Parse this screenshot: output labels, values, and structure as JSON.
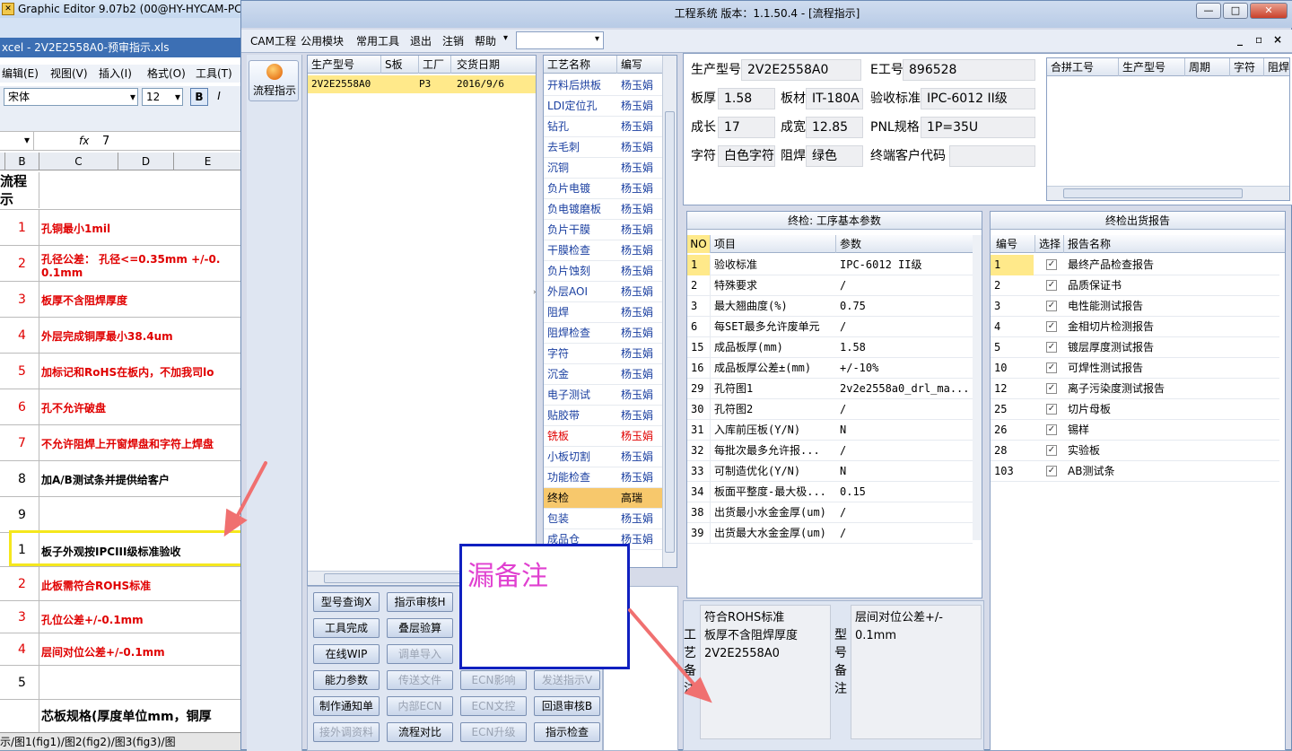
{
  "excel": {
    "title": "Graphic Editor 9.07b2 (00@HY-HYCAM-PC",
    "file_title": "xcel - 2V2E2558A0-预审指示.xls",
    "menu": [
      "编辑(E)",
      "视图(V)",
      "插入(I)",
      "格式(O)",
      "工具(T)"
    ],
    "font_name": "宋体",
    "font_size": "12",
    "formula_fx": "fx",
    "formula_value": "7",
    "columns": [
      "B",
      "C",
      "D",
      "E"
    ],
    "header_cell": "流程\n示",
    "rows": [
      {
        "n": "1",
        "text": "孔铜最小1mil",
        "red": true
      },
      {
        "n": "2",
        "text": "孔径公差： 孔径<=0.35mm +/-0.\n0.1mm",
        "red": true
      },
      {
        "n": "3",
        "text": "板厚不含阻焊厚度",
        "red": true
      },
      {
        "n": "4",
        "text": "外层完成铜厚最小38.4um",
        "red": true
      },
      {
        "n": "5",
        "text": "加标记和RoHS在板内，不加我司lo",
        "red": true
      },
      {
        "n": "6",
        "text": "孔不允许破盘",
        "red": true
      },
      {
        "n": "7",
        "text": "不允许阻焊上开窗焊盘和字符上焊盘",
        "red": true
      },
      {
        "n": "8",
        "text": "加A/B测试条并提供给客户",
        "red": false
      },
      {
        "n": "9",
        "text": "",
        "red": false
      },
      {
        "n": "1",
        "text": "板子外观按IPCIII级标准验收",
        "red": false
      },
      {
        "n": "2",
        "text": "此板需符合ROHS标准",
        "red": true
      },
      {
        "n": "3",
        "text": "孔位公差+/-0.1mm",
        "red": true
      },
      {
        "n": "4",
        "text": "层间对位公差+/-0.1mm",
        "red": true
      },
      {
        "n": "5",
        "text": "",
        "red": false
      },
      {
        "n": "",
        "text": "芯板规格(厚度单位mm，铜厚",
        "red": false
      }
    ],
    "sheet_tabs": "示/图1(fig1)/图2(fig2)/图3(fig3)/图"
  },
  "window": {
    "title": "工程系统   版本：1.1.50.4 - [流程指示]",
    "controls": [
      "—",
      "□",
      "✕"
    ],
    "menu": [
      "CAM工程",
      "公用模块",
      "常用工具",
      "退出",
      "注销",
      "帮助"
    ],
    "menu_arrow": "▾",
    "mdi_controls": [
      "_",
      "▫",
      "×"
    ]
  },
  "left_strip": {
    "label": "流程指示"
  },
  "orders": {
    "headers": [
      "生产型号",
      "S板",
      "工厂",
      "交货日期"
    ],
    "rows": [
      [
        "2V2E2558A0",
        "",
        "P3",
        "2016/9/6"
      ]
    ]
  },
  "process": {
    "headers": [
      "工艺名称",
      "编写"
    ],
    "rows": [
      [
        "开料后烘板",
        "杨玉娟"
      ],
      [
        "LDI定位孔",
        "杨玉娟"
      ],
      [
        "钻孔",
        "杨玉娟"
      ],
      [
        "去毛刺",
        "杨玉娟"
      ],
      [
        "沉铜",
        "杨玉娟"
      ],
      [
        "负片电镀",
        "杨玉娟"
      ],
      [
        "负电镀磨板",
        "杨玉娟"
      ],
      [
        "负片干膜",
        "杨玉娟"
      ],
      [
        "干膜检查",
        "杨玉娟"
      ],
      [
        "负片蚀刻",
        "杨玉娟"
      ],
      [
        "外层AOI",
        "杨玉娟"
      ],
      [
        "阻焊",
        "杨玉娟"
      ],
      [
        "阻焊检查",
        "杨玉娟"
      ],
      [
        "字符",
        "杨玉娟"
      ],
      [
        "沉金",
        "杨玉娟"
      ],
      [
        "电子测试",
        "杨玉娟"
      ],
      [
        "贴胶带",
        "杨玉娟"
      ],
      [
        "铣板",
        "杨玉娟"
      ],
      [
        "小板切割",
        "杨玉娟"
      ],
      [
        "功能检查",
        "杨玉娟"
      ],
      [
        "终检",
        "高瑞"
      ],
      [
        "包装",
        "杨玉娟"
      ],
      [
        "成品仓",
        "杨玉娟"
      ]
    ],
    "red_row": 17,
    "selected_row": 20
  },
  "buttons": [
    [
      "型号查询X",
      "指示审核H",
      "",
      ""
    ],
    [
      "工具完成",
      "叠层验算",
      "",
      ""
    ],
    [
      "在线WIP",
      "调单导入",
      "",
      ""
    ],
    [
      "能力参数",
      "传送文件",
      "ECN影响",
      "发送指示V"
    ],
    [
      "制作通知单",
      "内部ECN",
      "ECN文控",
      "回退审核B"
    ],
    [
      "接外调资料",
      "流程对比",
      "ECN升级",
      "指示检查"
    ]
  ],
  "note_popup": {
    "text": "漏备注"
  },
  "info": {
    "fields": [
      {
        "label": "生产型号",
        "value": "2V2E2558A0"
      },
      {
        "label": "E工号",
        "value": "896528"
      },
      {
        "label": "板厚",
        "value": "1.58"
      },
      {
        "label": "板材",
        "value": "IT-180A"
      },
      {
        "label": "验收标准",
        "value": "IPC-6012 II级"
      },
      {
        "label": "成长",
        "value": "17"
      },
      {
        "label": "成宽",
        "value": "12.85"
      },
      {
        "label": "PNL规格",
        "value": "1P=35U"
      },
      {
        "label": "字符",
        "value": "白色字符"
      },
      {
        "label": "阻焊",
        "value": "绿色"
      },
      {
        "label": "终端客户代码",
        "value": ""
      }
    ],
    "merge_headers": [
      "合拼工号",
      "生产型号",
      "周期",
      "字符",
      "阻焊"
    ]
  },
  "params": {
    "title": "终检: 工序基本参数",
    "headers": [
      "NO",
      "项目",
      "参数"
    ],
    "rows": [
      [
        "1",
        "验收标准",
        "IPC-6012 II级"
      ],
      [
        "2",
        "特殊要求",
        "/"
      ],
      [
        "3",
        "最大翘曲度(%)",
        "0.75"
      ],
      [
        "6",
        "每SET最多允许废单元",
        "/"
      ],
      [
        "15",
        "成品板厚(mm)",
        "1.58"
      ],
      [
        "16",
        "成品板厚公差±(mm)",
        "+/-10%"
      ],
      [
        "29",
        "孔符图1",
        "2v2e2558a0_drl_ma..."
      ],
      [
        "30",
        "孔符图2",
        "/"
      ],
      [
        "31",
        "入库前压板(Y/N)",
        "N"
      ],
      [
        "32",
        "每批次最多允许报...",
        "/"
      ],
      [
        "33",
        "可制造优化(Y/N)",
        "N"
      ],
      [
        "34",
        "板面平整度-最大极...",
        "0.15"
      ],
      [
        "38",
        "出货最小水金金厚(um)",
        "/"
      ],
      [
        "39",
        "出货最大水金金厚(um)",
        "/"
      ]
    ]
  },
  "report": {
    "title": "终检出货报告",
    "headers": [
      "编号",
      "选择",
      "报告名称"
    ],
    "rows": [
      [
        "1",
        "最终产品检查报告"
      ],
      [
        "2",
        "品质保证书"
      ],
      [
        "3",
        "电性能测试报告"
      ],
      [
        "4",
        "金相切片检测报告"
      ],
      [
        "5",
        "镀层厚度测试报告"
      ],
      [
        "10",
        "可焊性测试报告"
      ],
      [
        "12",
        "离子污染度测试报告"
      ],
      [
        "25",
        "切片母板"
      ],
      [
        "26",
        "锡样"
      ],
      [
        "28",
        "实验板"
      ],
      [
        "103",
        "AB测试条"
      ]
    ]
  },
  "notes": {
    "craft_label": "工艺备注",
    "craft_text": "符合ROHS标准\n板厚不含阻焊厚度\n2V2E2558A0",
    "model_label": "型号备注",
    "model_text": "层间对位公差+/-\n0.1mm"
  },
  "colors": {
    "highlight": "#ffe98a",
    "select": "#f7c86c",
    "red": "#e00000",
    "note_pink": "#e040d0",
    "arrow": "#f07070",
    "popup_border": "#1020c0"
  }
}
